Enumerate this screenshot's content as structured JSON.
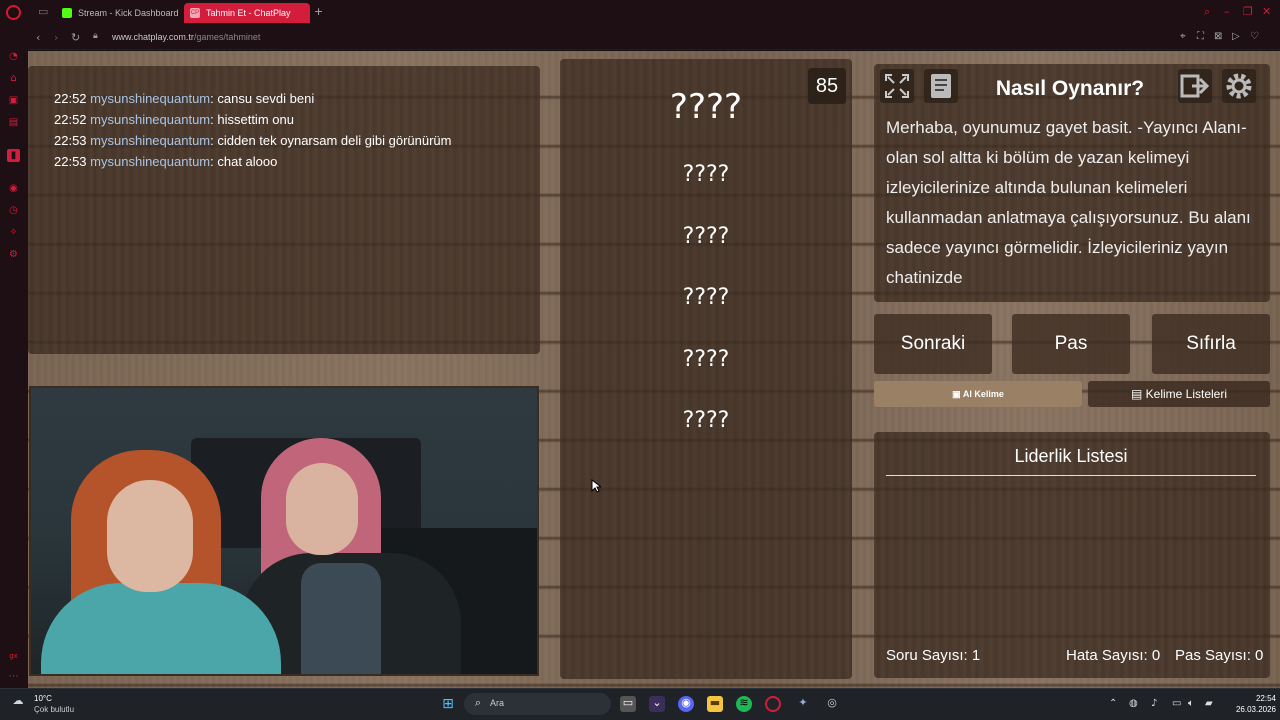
{
  "browser": {
    "tabs": [
      {
        "title": "Stream - Kick Dashboard",
        "favicon_color": "#53fc18"
      },
      {
        "title": "Tahmin Et - ChatPlay",
        "favicon_color": "#f2a7b5",
        "favicon_text": "CP",
        "active": true
      }
    ],
    "new_tab": "+",
    "url_host": "www.chatplay.com.tr",
    "url_path": "/games/tahminet"
  },
  "chat": {
    "messages": [
      {
        "time": "22:52",
        "user": "mysunshinequantum",
        "text": ": cansu sevdi beni"
      },
      {
        "time": "22:52",
        "user": "mysunshinequantum",
        "text": ": hissettim onu"
      },
      {
        "time": "22:53",
        "user": "mysunshinequantum",
        "text": ": cidden tek oynarsam deli gibi görünürüm"
      },
      {
        "time": "22:53",
        "user": "mysunshinequantum",
        "text": ": chat alooo"
      }
    ]
  },
  "game": {
    "timer": "85",
    "main_word": "????",
    "forbidden_words": [
      "????",
      "????",
      "????",
      "????",
      "????"
    ]
  },
  "info": {
    "title": "Nasıl Oynanır?",
    "text": "Merhaba, oyunumuz gayet basit. -Yayıncı Alanı- olan sol altta ki bölüm de yazan kelimeyi izleyicilerinize altında bulunan kelimeleri kullanmadan anlatmaya çalışıyorsunuz. Bu alanı sadece yayıncı görmelidir. İzleyicileriniz yayın chatinizde"
  },
  "actions": {
    "next": "Sonraki",
    "pass": "Pas",
    "reset": "Sıfırla",
    "get_word": "Al Kelime",
    "word_lists": "Kelime Listeleri"
  },
  "leaderboard": {
    "title": "Liderlik Listesi",
    "question_label": "Soru Sayısı:",
    "question_count": "1",
    "error_label": "Hata Sayısı:",
    "error_count": "0",
    "pass_label": "Pas Sayısı:",
    "pass_count": "0"
  },
  "taskbar": {
    "weather_temp": "10°C",
    "weather_desc": "Çok bulutlu",
    "search_placeholder": "Ara",
    "time": "22:54",
    "date": "26.03.2026"
  },
  "colors": {
    "accent": "#d21d3c",
    "username": "#a9c4e4"
  }
}
